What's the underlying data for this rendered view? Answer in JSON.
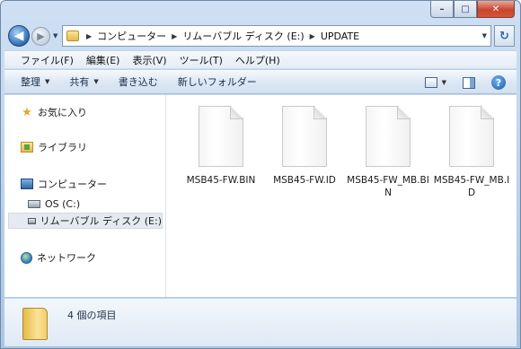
{
  "window": {
    "caption": {
      "minimize": "–",
      "maximize": "□",
      "close": "✕"
    }
  },
  "nav": {
    "back_glyph": "◀",
    "forward_glyph": "▶",
    "breadcrumbs": [
      "コンピューター",
      "リムーバブル ディスク (E:)",
      "UPDATE"
    ],
    "refresh_glyph": "↻"
  },
  "menubar": {
    "items": [
      "ファイル(F)",
      "編集(E)",
      "表示(V)",
      "ツール(T)",
      "ヘルプ(H)"
    ]
  },
  "commandbar": {
    "organize": "整理",
    "share": "共有",
    "burn": "書き込む",
    "new_folder": "新しいフォルダー",
    "help_glyph": "?"
  },
  "navpane": {
    "favorites": "お気に入り",
    "libraries": "ライブラリ",
    "computer": "コンピューター",
    "os_drive": "OS (C:)",
    "removable": "リムーバブル ディスク (E:)",
    "network": "ネットワーク"
  },
  "files": [
    {
      "name": "MSB45-FW.BIN"
    },
    {
      "name": "MSB45-FW.ID"
    },
    {
      "name": "MSB45-FW_MB.BIN"
    },
    {
      "name": "MSB45-FW_MB.ID"
    }
  ],
  "details": {
    "item_count": "4 個の項目"
  }
}
